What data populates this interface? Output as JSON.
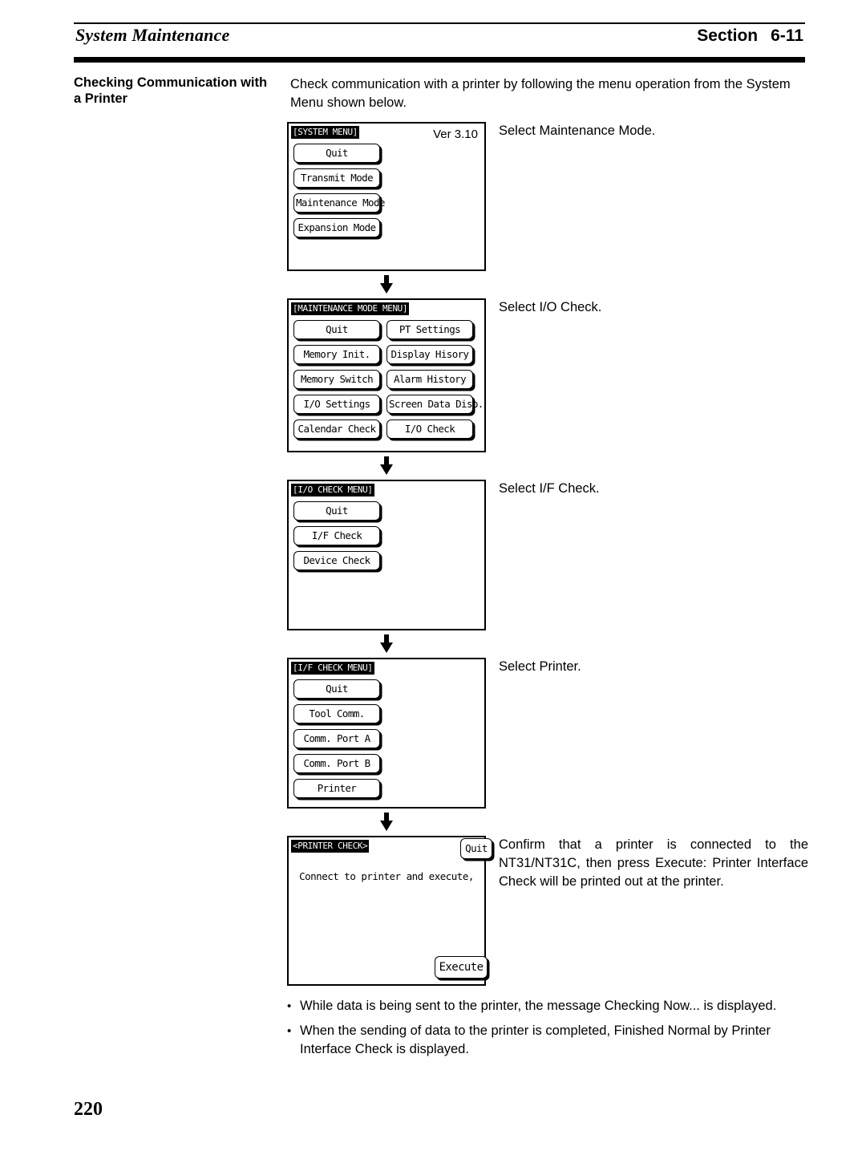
{
  "header": {
    "title": "System Maintenance",
    "section_label": "Section",
    "section_number": "6-11"
  },
  "sidebar": {
    "heading": "Checking Communication with a Printer"
  },
  "intro": {
    "text": "Check communication with a printer by following the menu operation from the System Menu shown below."
  },
  "steps": [
    {
      "panel": {
        "title": "[SYSTEM MENU]",
        "version": "Ver 3.10",
        "columns": [
          {
            "buttons": [
              "Quit",
              "Transmit Mode",
              "Maintenance Mode",
              "Expansion Mode"
            ]
          }
        ]
      },
      "caption": "Select Maintenance Mode."
    },
    {
      "panel": {
        "title": "[MAINTENANCE MODE MENU]",
        "columns": [
          {
            "buttons": [
              "Quit",
              "Memory Init.",
              "Memory Switch",
              "I/O Settings",
              "Calendar Check"
            ]
          },
          {
            "buttons": [
              "PT Settings",
              "Display Hisory",
              "Alarm History",
              "Screen Data Disp.",
              "I/O Check"
            ]
          }
        ]
      },
      "caption": "Select I/O Check."
    },
    {
      "panel": {
        "title": "[I/O CHECK MENU]",
        "columns": [
          {
            "buttons": [
              "Quit",
              "I/F Check",
              "Device Check"
            ]
          }
        ]
      },
      "caption": "Select I/F Check."
    },
    {
      "panel": {
        "title": "[I/F CHECK MENU]",
        "columns": [
          {
            "buttons": [
              "Quit",
              "Tool Comm.",
              "Comm. Port A",
              "Comm. Port B",
              "Printer"
            ]
          }
        ]
      },
      "caption": "Select Printer."
    }
  ],
  "printer_check": {
    "panel": {
      "title": "<PRINTER CHECK>",
      "message": "Connect to printer and execute,",
      "quit_label": "Quit",
      "execute_label": "Execute"
    },
    "caption": "Confirm that a printer is connected to the NT31/NT31C, then press Execute: Printer Interface Check will be printed out at the printer."
  },
  "bullets": [
    {
      "marker": "•",
      "text": "While data is being sent to the printer, the message Checking Now... is displayed."
    },
    {
      "marker": "•",
      "text": "When the sending of data to the printer is completed, Finished Normal by Printer Interface Check is displayed."
    }
  ],
  "page_number": "220"
}
